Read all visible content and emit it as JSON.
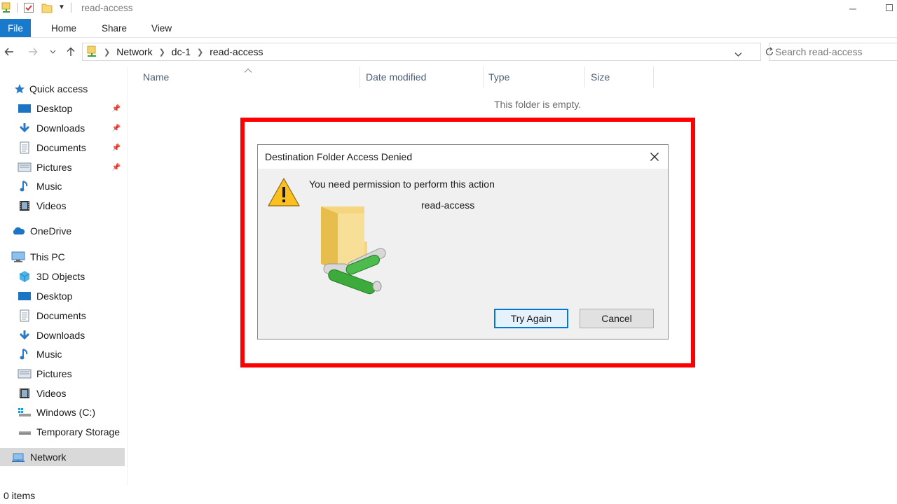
{
  "window": {
    "title": "read-access"
  },
  "ribbon": {
    "tabs": [
      "File",
      "Home",
      "Share",
      "View"
    ]
  },
  "address": {
    "crumbs": [
      "Network",
      "dc-1",
      "read-access"
    ],
    "search_placeholder": "Search read-access"
  },
  "sidebar": {
    "quick_access": "Quick access",
    "quick_items": [
      {
        "label": "Desktop",
        "icon": "desktop-icon",
        "pinned": true
      },
      {
        "label": "Downloads",
        "icon": "downloads-icon",
        "pinned": true
      },
      {
        "label": "Documents",
        "icon": "documents-icon",
        "pinned": true
      },
      {
        "label": "Pictures",
        "icon": "pictures-icon",
        "pinned": true
      },
      {
        "label": "Music",
        "icon": "music-icon",
        "pinned": false
      },
      {
        "label": "Videos",
        "icon": "videos-icon",
        "pinned": false
      }
    ],
    "onedrive": "OneDrive",
    "this_pc": "This PC",
    "pc_items": [
      {
        "label": "3D Objects",
        "icon": "3d-objects-icon"
      },
      {
        "label": "Desktop",
        "icon": "desktop-icon"
      },
      {
        "label": "Documents",
        "icon": "documents-icon"
      },
      {
        "label": "Downloads",
        "icon": "downloads-icon"
      },
      {
        "label": "Music",
        "icon": "music-icon"
      },
      {
        "label": "Pictures",
        "icon": "pictures-icon"
      },
      {
        "label": "Videos",
        "icon": "videos-icon"
      },
      {
        "label": "Windows (C:)",
        "icon": "drive-icon"
      },
      {
        "label": "Temporary Storage",
        "icon": "drive-icon"
      }
    ],
    "network": "Network"
  },
  "columns": {
    "name": "Name",
    "date": "Date modified",
    "type": "Type",
    "size": "Size"
  },
  "content": {
    "empty_message": "This folder is empty."
  },
  "dialog": {
    "title": "Destination Folder Access Denied",
    "message": "You need permission to perform this action",
    "folder": "read-access",
    "try_again": "Try Again",
    "cancel": "Cancel"
  },
  "status": {
    "items": "0 items"
  },
  "colors": {
    "accent": "#1979ca",
    "highlight": "#ff0000",
    "selected": "#d9d9d9",
    "warning": "#fcbf20"
  }
}
